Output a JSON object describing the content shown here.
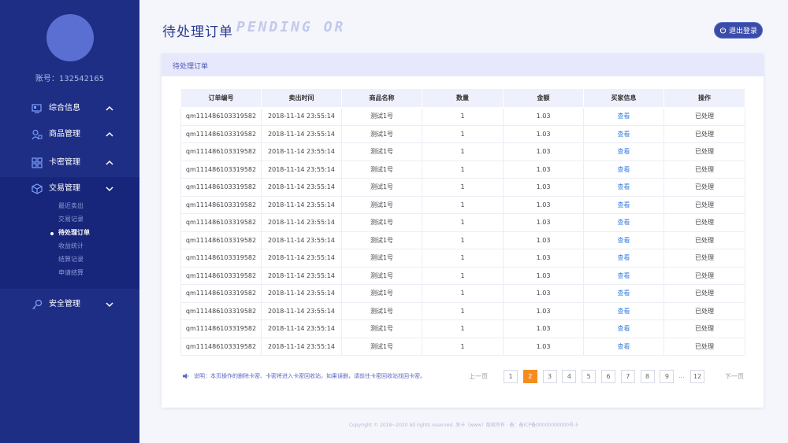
{
  "sidebar": {
    "account_label": "账号：132542165",
    "nav": [
      {
        "label": "综合信息",
        "icon": "dashboard-icon"
      },
      {
        "label": "商品管理",
        "icon": "user-goods-icon"
      },
      {
        "label": "卡密管理",
        "icon": "grid-icon"
      },
      {
        "label": "交易管理",
        "icon": "cube-icon"
      },
      {
        "label": "安全管理",
        "icon": "key-icon"
      }
    ],
    "sub_items": [
      "最近卖出",
      "交易记录",
      "待处理订单",
      "收益统计",
      "结算记录",
      "申请结算"
    ],
    "active_sub": "待处理订单"
  },
  "header": {
    "title": "待处理订单",
    "title_en": "PENDING OR",
    "logout_label": "退出登录"
  },
  "panel": {
    "title": "待处理订单",
    "columns": [
      "订单编号",
      "卖出时间",
      "商品名称",
      "数量",
      "金额",
      "买家信息",
      "操作"
    ],
    "rows": [
      [
        "qm111486103319582",
        "2018-11-14  23:55:14",
        "测试1号",
        "1",
        "1.03",
        "查看",
        "已处理"
      ],
      [
        "qm111486103319582",
        "2018-11-14  23:55:14",
        "测试1号",
        "1",
        "1.03",
        "查看",
        "已处理"
      ],
      [
        "qm111486103319582",
        "2018-11-14  23:55:14",
        "测试1号",
        "1",
        "1.03",
        "查看",
        "已处理"
      ],
      [
        "qm111486103319582",
        "2018-11-14  23:55:14",
        "测试1号",
        "1",
        "1.03",
        "查看",
        "已处理"
      ],
      [
        "qm111486103319582",
        "2018-11-14  23:55:14",
        "测试1号",
        "1",
        "1.03",
        "查看",
        "已处理"
      ],
      [
        "qm111486103319582",
        "2018-11-14  23:55:14",
        "测试1号",
        "1",
        "1.03",
        "查看",
        "已处理"
      ],
      [
        "qm111486103319582",
        "2018-11-14  23:55:14",
        "测试1号",
        "1",
        "1.03",
        "查看",
        "已处理"
      ],
      [
        "qm111486103319582",
        "2018-11-14  23:55:14",
        "测试1号",
        "1",
        "1.03",
        "查看",
        "已处理"
      ],
      [
        "qm111486103319582",
        "2018-11-14  23:55:14",
        "测试1号",
        "1",
        "1.03",
        "查看",
        "已处理"
      ],
      [
        "qm111486103319582",
        "2018-11-14  23:55:14",
        "测试1号",
        "1",
        "1.03",
        "查看",
        "已处理"
      ],
      [
        "qm111486103319582",
        "2018-11-14  23:55:14",
        "测试1号",
        "1",
        "1.03",
        "查看",
        "已处理"
      ],
      [
        "qm111486103319582",
        "2018-11-14  23:55:14",
        "测试1号",
        "1",
        "1.03",
        "查看",
        "已处理"
      ],
      [
        "qm111486103319582",
        "2018-11-14  23:55:14",
        "测试1号",
        "1",
        "1.03",
        "查看",
        "已处理"
      ],
      [
        "qm111486103319582",
        "2018-11-14  23:55:14",
        "测试1号",
        "1",
        "1.03",
        "查看",
        "已处理"
      ]
    ],
    "notice": "说明：本页操作的删除卡密、卡密将进入卡密回收站，如果误删，请前往卡密回收站找回卡密。"
  },
  "pagination": {
    "prev_label": "上一页",
    "next_label": "下一页",
    "pages": [
      "1",
      "2",
      "3",
      "4",
      "5",
      "6",
      "7",
      "8",
      "9"
    ],
    "ellipsis": "...",
    "last_page": "12",
    "current": "2"
  },
  "footer": "Copyright © 2018~2020 All rights reserved. 发卡（www）版权所有 · 备：备ICP备00000000000号-5",
  "colors": {
    "sidebar_bg": "#1e2e85",
    "accent": "#3b4ca8",
    "active_page": "#f58d1e",
    "link": "#3a7ee0"
  }
}
